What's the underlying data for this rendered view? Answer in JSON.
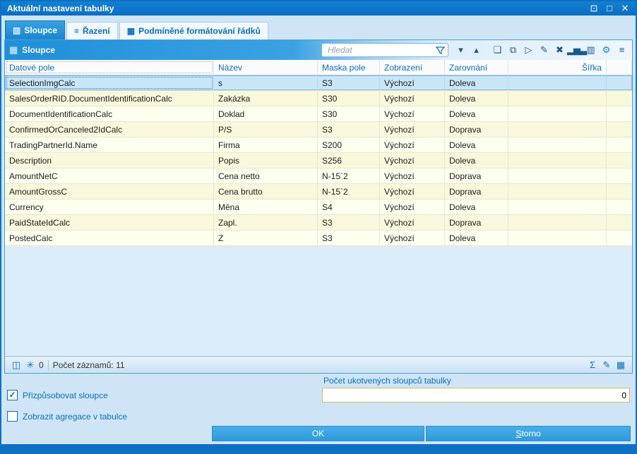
{
  "window": {
    "title": "Aktuální nastavení tabulky",
    "controls": [
      {
        "name": "window-restore-icon",
        "glyph": "⊡"
      },
      {
        "name": "window-maximize-icon",
        "glyph": "□"
      },
      {
        "name": "window-close-icon",
        "glyph": "✕"
      }
    ]
  },
  "tabs": [
    {
      "label": "Sloupce",
      "icon": "▥"
    },
    {
      "label": "Řazení",
      "icon": "≡"
    },
    {
      "label": "Podmíněné formátování řádků",
      "icon": "▦"
    }
  ],
  "toolbar": {
    "title": "Sloupce",
    "title_icon": "▦",
    "search_placeholder": "Hledat",
    "icons": [
      {
        "name": "filter-dropdown-icon",
        "glyph": "▾"
      },
      {
        "name": "scroll-top-icon",
        "glyph": "▴"
      },
      {
        "name": "new-item-icon",
        "glyph": "❏"
      },
      {
        "name": "copy-icon",
        "glyph": "⧉"
      },
      {
        "name": "apply-icon",
        "glyph": "▷"
      },
      {
        "name": "edit-icon",
        "glyph": "✎"
      },
      {
        "name": "delete-icon",
        "glyph": "✖"
      },
      {
        "name": "chart-icon",
        "glyph": "▂▅▃"
      },
      {
        "name": "columns-icon",
        "glyph": "▥"
      },
      {
        "name": "settings-gear-icon",
        "glyph": "⚙",
        "cls": "accent"
      },
      {
        "name": "menu-icon",
        "glyph": "≡"
      }
    ]
  },
  "table": {
    "selected_index": 0,
    "columns": [
      "Datové pole",
      "Název",
      "Maska pole",
      "Zobrazení",
      "Zarovnání",
      "Šířka"
    ],
    "rows": [
      [
        "SelectionImgCalc",
        "s",
        "S3",
        "Výchozí",
        "Doleva",
        ""
      ],
      [
        "SalesOrderRID.DocumentIdentificationCalc",
        "Zakázka",
        "S30",
        "Výchozí",
        "Doleva",
        ""
      ],
      [
        "DocumentIdentificationCalc",
        "Doklad",
        "S30",
        "Výchozí",
        "Doleva",
        ""
      ],
      [
        "ConfirmedOrCanceled2IdCalc",
        "P/S",
        "S3",
        "Výchozí",
        "Doprava",
        ""
      ],
      [
        "TradingPartnerId.Name",
        "Firma",
        "S200",
        "Výchozí",
        "Doleva",
        ""
      ],
      [
        "Description",
        "Popis",
        "S256",
        "Výchozí",
        "Doleva",
        ""
      ],
      [
        "AmountNetC",
        "Cena netto",
        "N-15`2",
        "Výchozí",
        "Doprava",
        ""
      ],
      [
        "AmountGrossC",
        "Cena brutto",
        "N-15`2",
        "Výchozí",
        "Doprava",
        ""
      ],
      [
        "Currency",
        "Měna",
        "S4",
        "Výchozí",
        "Doleva",
        ""
      ],
      [
        "PaidStateIdCalc",
        "Zapl.",
        "S3",
        "Výchozí",
        "Doprava",
        ""
      ],
      [
        "PostedCalc",
        "Z",
        "S3",
        "Výchozí",
        "Doleva",
        ""
      ]
    ]
  },
  "statusbar": {
    "left_icons": [
      {
        "name": "book-icon",
        "glyph": "◫"
      },
      {
        "name": "snowflake-icon",
        "glyph": "✳"
      }
    ],
    "frozen_count": "0",
    "records_label": "Počet záznamů: 11",
    "right_icons": [
      {
        "name": "sum-icon",
        "glyph": "Σ"
      },
      {
        "name": "edit-disabled-icon",
        "glyph": "✎",
        "cls": "disabled"
      },
      {
        "name": "table-edit-icon",
        "glyph": "▦",
        "cls": "accent"
      }
    ]
  },
  "footer": {
    "anchored_columns_label": "Počet ukotvených sloupců tabulky",
    "anchored_columns_value": "0",
    "fit_columns": {
      "label": "Přizpůsobovat sloupce",
      "checked": true,
      "glyph": "✓"
    },
    "show_aggregations": {
      "label": "Zobrazit agregace v tabulce",
      "checked": false,
      "glyph": ""
    },
    "ok_label": "OK",
    "cancel_mnemonic": "S",
    "cancel_rest": "torno"
  }
}
